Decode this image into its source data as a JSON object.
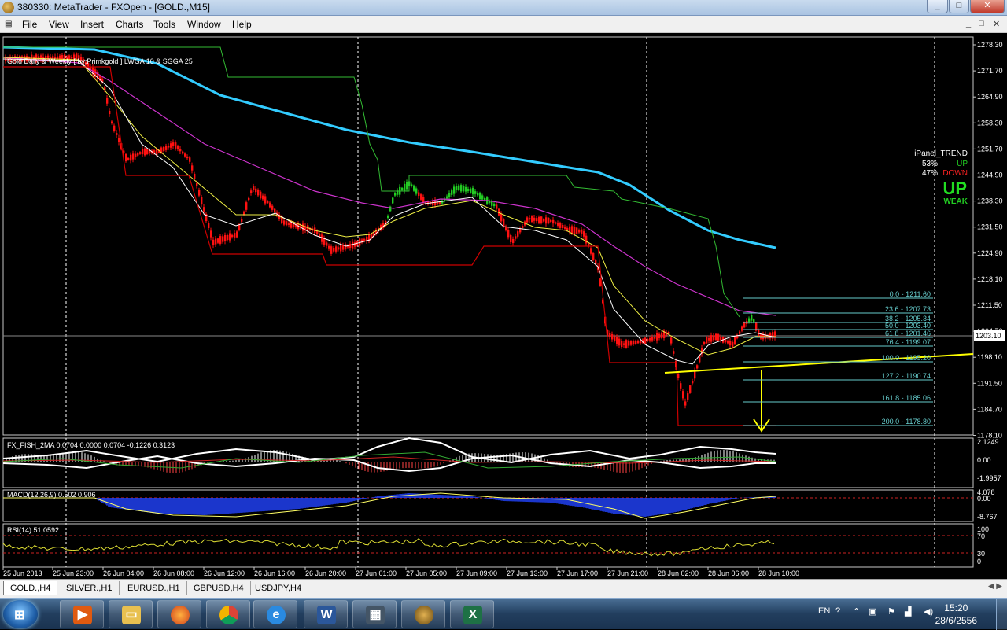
{
  "window": {
    "title": "380330: MetaTrader - FXOpen - [GOLD.,M15]",
    "buttons": [
      "_",
      "□",
      "✕"
    ]
  },
  "menu": {
    "items": [
      "File",
      "View",
      "Insert",
      "Charts",
      "Tools",
      "Window",
      "Help"
    ],
    "child_controls": [
      "_",
      "□",
      "✕"
    ]
  },
  "chart": {
    "indicator_caption": "Gold Daily & Weekly [ by:Primkgold ] LWGA 10  &  SGGA 25",
    "price_axis": {
      "ticks": [
        "1278.30",
        "1271.70",
        "1264.90",
        "1258.30",
        "1251.70",
        "1244.90",
        "1238.30",
        "1231.50",
        "1224.90",
        "1218.10",
        "1211.50",
        "1204.70",
        "1198.10",
        "1191.50",
        "1184.70",
        "1178.10"
      ],
      "current_price": "1203.10"
    },
    "time_axis": {
      "ticks": [
        "25 Jun 2013",
        "25 Jun 23:00",
        "26 Jun 04:00",
        "26 Jun 08:00",
        "26 Jun 12:00",
        "26 Jun 16:00",
        "26 Jun 20:00",
        "27 Jun 01:00",
        "27 Jun 05:00",
        "27 Jun 09:00",
        "27 Jun 13:00",
        "27 Jun 17:00",
        "27 Jun 21:00",
        "28 Jun 02:00",
        "28 Jun 06:00",
        "28 Jun 10:00"
      ]
    },
    "fibonacci": [
      "0.0 - 1211.60",
      "23.6 - 1207.73",
      "38.2 - 1205.34",
      "50.0 - 1203.40",
      "61.8 - 1201.46",
      "76.4 - 1199.07",
      "100.0 - 1195.20",
      "127.2 - 1190.74",
      "161.8 - 1185.06",
      "200.0 - 1178.80"
    ],
    "ipanel": {
      "title": "iPanel_TREND",
      "up_pct": "53%",
      "up_label": "UP",
      "down_pct": "47%",
      "down_label": "DOWN",
      "signal": "UP",
      "strength": "WEAK"
    },
    "fisher": {
      "label": "FX_FISH_2MA 0.0704 0.0000 0.0704 -0.1226 0.3123",
      "ticks": [
        "2.1249",
        "0.00",
        "-1.9957"
      ]
    },
    "macd": {
      "label": "MACD(12,26,9) 0.502 0.906",
      "ticks": [
        "4.078",
        "0.00",
        "-8.767"
      ]
    },
    "rsi": {
      "label": "RSI(14) 51.0592",
      "ticks": [
        "100",
        "70",
        "30",
        "0"
      ]
    },
    "colors": {
      "bull": "#22cc22",
      "bear": "#ff0000",
      "cyan_ma": "#33ccff",
      "magenta_ma": "#cc33cc",
      "green_line": "#33bb33",
      "yellow": "#ffff00",
      "fib": "#66cccc"
    }
  },
  "tabs": [
    "GOLD.,H4",
    "SILVER.,H1",
    "EURUSD.,H1",
    "GBPUSD,H4",
    "USDJPY,H4"
  ],
  "taskbar": {
    "start": "⊞",
    "apps": [
      "media-player-icon",
      "folder-icon",
      "firefox-icon",
      "chrome-icon",
      "ie-icon",
      "word-icon",
      "metatrader-icon",
      "gold-icon",
      "excel-icon"
    ],
    "lang": "EN",
    "time": "15:20",
    "date": "28/6/2556"
  }
}
